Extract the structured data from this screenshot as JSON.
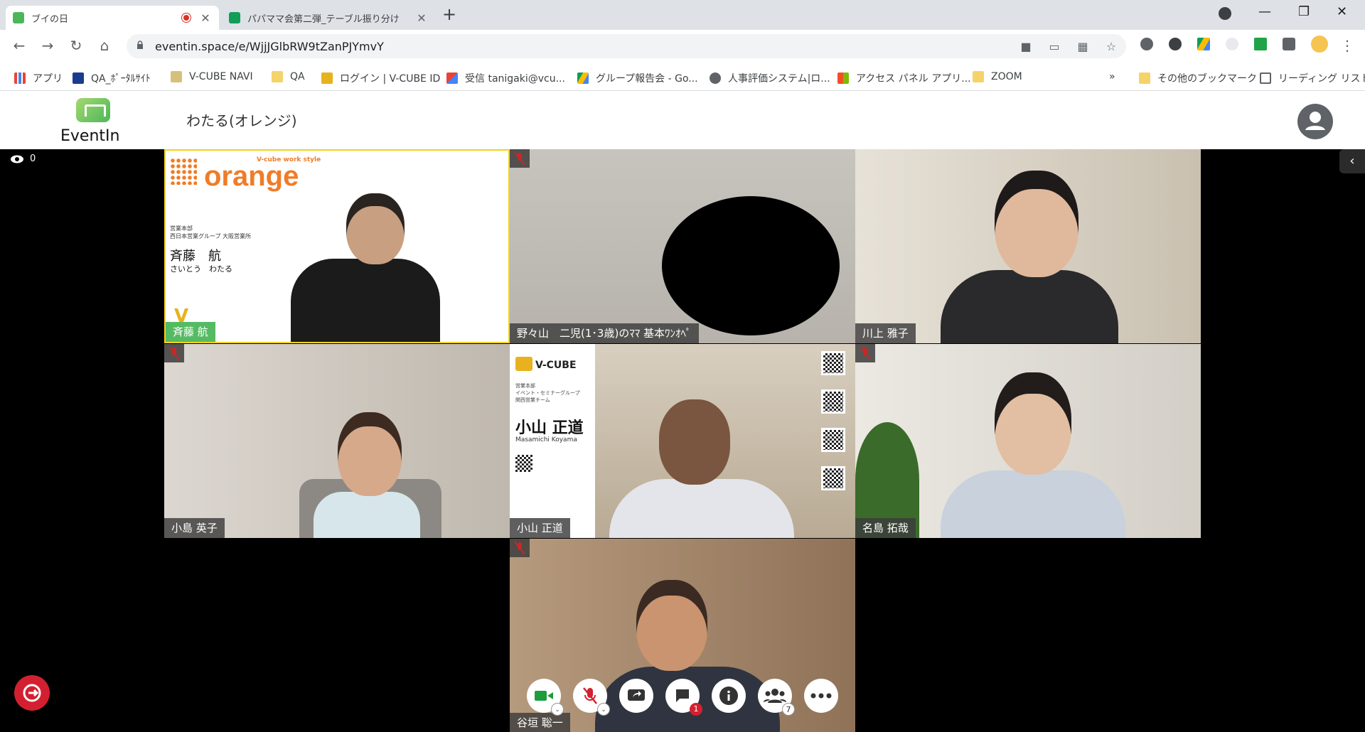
{
  "browser": {
    "tabs": [
      {
        "title": "ブイの日",
        "active": true,
        "favicon_color": "#4cb75a"
      },
      {
        "title": "パパママ会第二弾_テーブル振り分け",
        "active": false,
        "favicon_color": "#0f9d58"
      }
    ],
    "url": "eventin.space/e/WjjJGlbRW9tZanPJYmvY",
    "bookmarks": [
      {
        "label": "アプリ",
        "icon": "apps-grid-icon"
      },
      {
        "label": "QA_ﾎﾟｰﾀﾙｻｲﾄ",
        "icon": "portal-icon"
      },
      {
        "label": "V-CUBE NAVI",
        "icon": "navi-icon"
      },
      {
        "label": "QA",
        "icon": "folder-icon"
      },
      {
        "label": "ログイン | V-CUBE ID",
        "icon": "vcube-icon"
      },
      {
        "label": "受信 tanigaki@vcu...",
        "icon": "gmail-icon"
      },
      {
        "label": "グループ報告会 - Go...",
        "icon": "drive-icon"
      },
      {
        "label": "人事評価システム|ロ...",
        "icon": "globe-icon"
      },
      {
        "label": "アクセス パネル アプリ...",
        "icon": "windows-icon"
      },
      {
        "label": "ZOOM",
        "icon": "folder-icon"
      },
      {
        "label": "»",
        "icon": ""
      },
      {
        "label": "その他のブックマーク",
        "icon": "folder-icon"
      },
      {
        "label": "リーディング リスト",
        "icon": "reading-list-icon"
      }
    ]
  },
  "app": {
    "logo_text": "EventIn",
    "room_name": "わたる(オレンジ)",
    "viewer_count": "0"
  },
  "tiles": [
    {
      "name": "斉藤 航",
      "muted": false,
      "active_speaker": true,
      "bg": "#ffffff"
    },
    {
      "name": "野々山　二児(1･3歳)のﾏﾏ  基本ﾜﾝｵﾍﾟ",
      "muted": true,
      "active_speaker": false,
      "bg": "#c9c6bf"
    },
    {
      "name": "川上 雅子",
      "muted": false,
      "active_speaker": false,
      "bg": "#d8d1c4"
    },
    {
      "name": "小島 英子",
      "muted": true,
      "active_speaker": false,
      "bg": "#cfcac3"
    },
    {
      "name": "小山 正道",
      "muted": false,
      "active_speaker": false,
      "bg": "#cfc9bd"
    },
    {
      "name": "名島 拓哉",
      "muted": true,
      "active_speaker": false,
      "bg": "#d9d6cf"
    },
    {
      "name": "谷垣 聡一",
      "muted": true,
      "active_speaker": false,
      "bg": "#a78c72"
    }
  ],
  "orange_card": {
    "tagline": "V-cube work style",
    "brand": "orange",
    "dept1": "営業本部",
    "dept2": "西日本営業グループ 大阪営業所",
    "person": "斉藤　航",
    "reading": "さいとう　わたる"
  },
  "vcube_card": {
    "brand": "V-CUBE",
    "dept": "営業本部\nイベント・セミナーグループ\n関西営業チーム",
    "person": "小山 正道",
    "romaji": "Masamichi Koyama"
  },
  "controls": {
    "chat_badge": "1",
    "participants_badge": "7"
  },
  "colors": {
    "brand_green": "#4cb75a",
    "orange": "#f07c27",
    "leave_red": "#d32030",
    "badge_red": "#d32030",
    "speaker_border": "#f2d31b"
  }
}
